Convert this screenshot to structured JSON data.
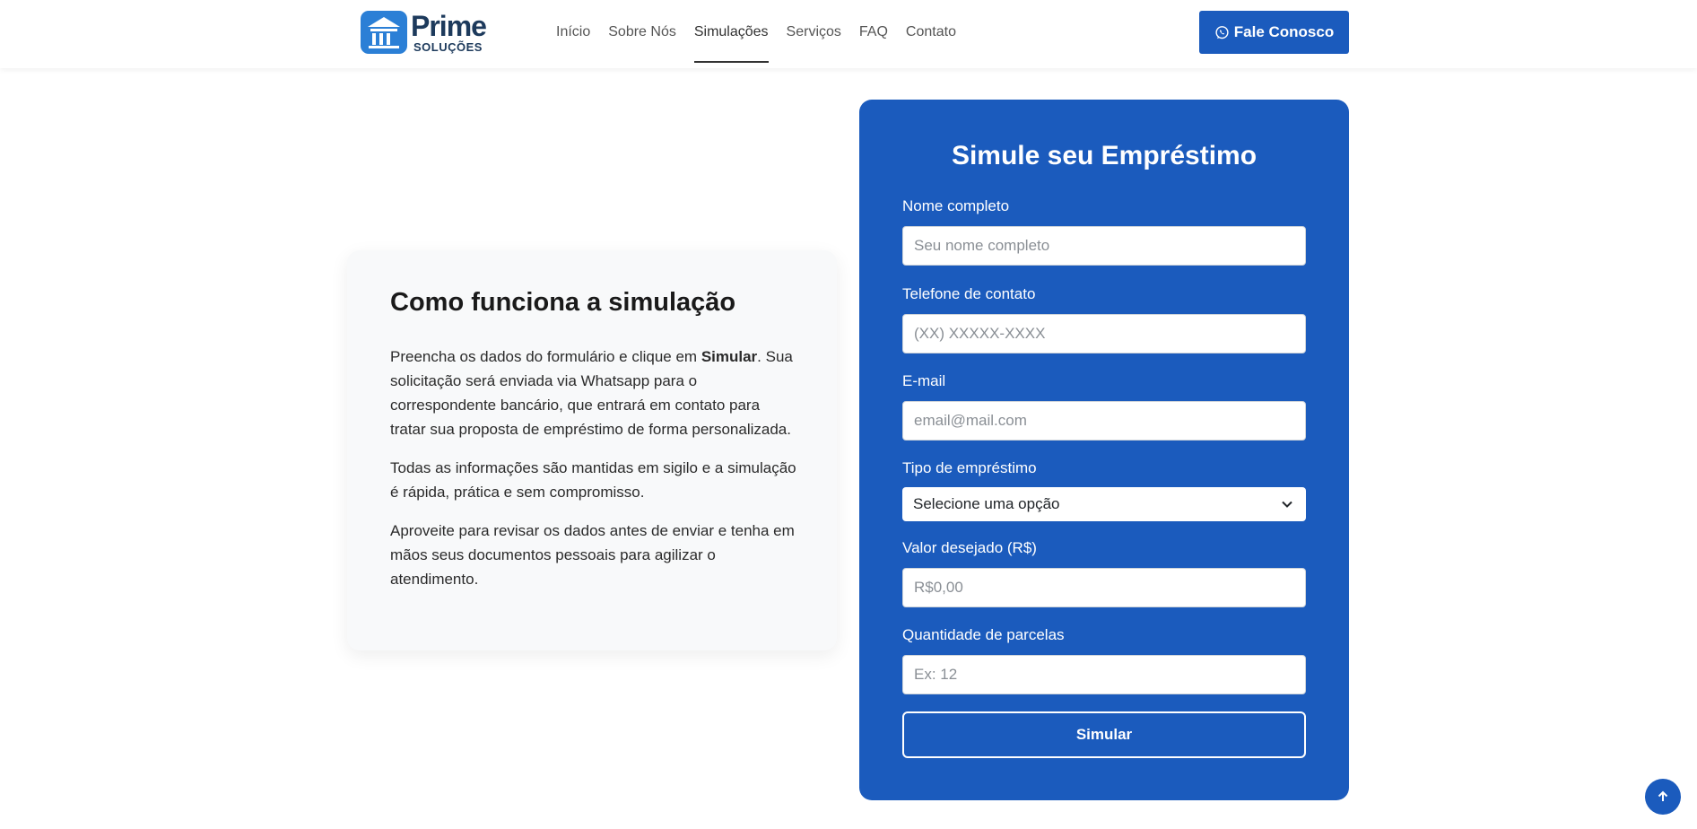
{
  "brand": {
    "name": "Prime",
    "subtitle": "SOLUÇÕES"
  },
  "nav": {
    "items": [
      {
        "label": "Início"
      },
      {
        "label": "Sobre Nós"
      },
      {
        "label": "Simulações",
        "active": true
      },
      {
        "label": "Serviços"
      },
      {
        "label": "FAQ"
      },
      {
        "label": "Contato"
      }
    ]
  },
  "header": {
    "cta_label": "Fale Conosco",
    "cta_icon": "whatsapp-icon"
  },
  "info": {
    "title": "Como funciona a simulação",
    "p1_before": "Preencha os dados do formulário e clique em ",
    "p1_bold": "Simular",
    "p1_after": ". Sua solicitação será enviada via Whatsapp para o correspondente bancário, que entrará em contato para tratar sua proposta de empréstimo de forma personalizada.",
    "p2": "Todas as informações são mantidas em sigilo e a simulação é rápida, prática e sem compromisso.",
    "p3": "Aproveite para revisar os dados antes de enviar e tenha em mãos seus documentos pessoais para agilizar o atendimento."
  },
  "form": {
    "title": "Simule seu Empréstimo",
    "name": {
      "label": "Nome completo",
      "placeholder": "Seu nome completo"
    },
    "phone": {
      "label": "Telefone de contato",
      "placeholder": "(XX) XXXXX-XXXX"
    },
    "email": {
      "label": "E-mail",
      "placeholder": "email@mail.com"
    },
    "loan_type": {
      "label": "Tipo de empréstimo",
      "selected": "Selecione uma opção"
    },
    "amount": {
      "label": "Valor desejado (R$)",
      "placeholder": "R$0,00"
    },
    "installments": {
      "label": "Quantidade de parcelas",
      "placeholder": "Ex: 12"
    },
    "submit_label": "Simular"
  },
  "colors": {
    "primary": "#1b5bbd",
    "card_bg": "#f8f9fa",
    "logo_text": "#1d3a5c"
  },
  "icons": {
    "back_to_top": "arrow-up-icon",
    "select": "chevron-down-icon"
  }
}
